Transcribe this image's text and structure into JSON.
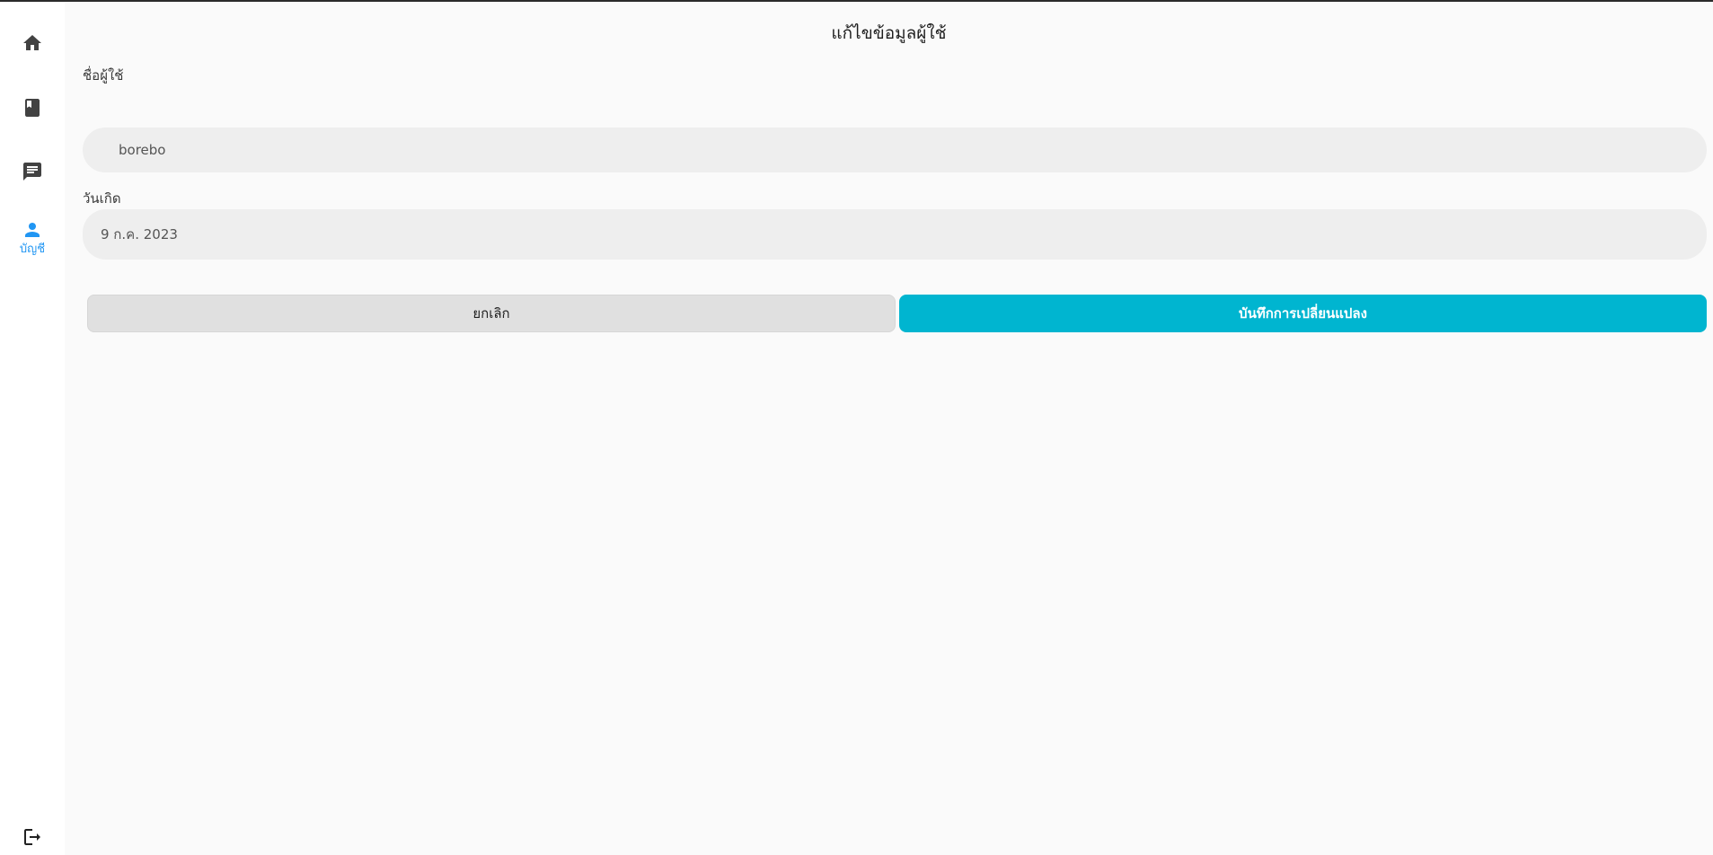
{
  "sidebar": {
    "items": [
      {
        "icon": "home-icon",
        "label": ""
      },
      {
        "icon": "book-icon",
        "label": ""
      },
      {
        "icon": "chat-icon",
        "label": ""
      },
      {
        "icon": "person-icon",
        "label": "บัญชี",
        "active": true
      }
    ],
    "logout_icon": "logout-icon"
  },
  "page": {
    "title": "แก้ไขข้อมูลผู้ใช้"
  },
  "form": {
    "username_label": "ชื่อผู้ใช้",
    "username_value": "borebo",
    "birthdate_label": "วันเกิด",
    "birthdate_value": "9 ก.ค. 2023"
  },
  "actions": {
    "cancel_label": "ยกเลิก",
    "save_label": "บันทึกการเปลี่ยนแปลง"
  },
  "colors": {
    "accent": "#00b5d0",
    "active_nav": "#2196f3",
    "icon": "#424242"
  }
}
